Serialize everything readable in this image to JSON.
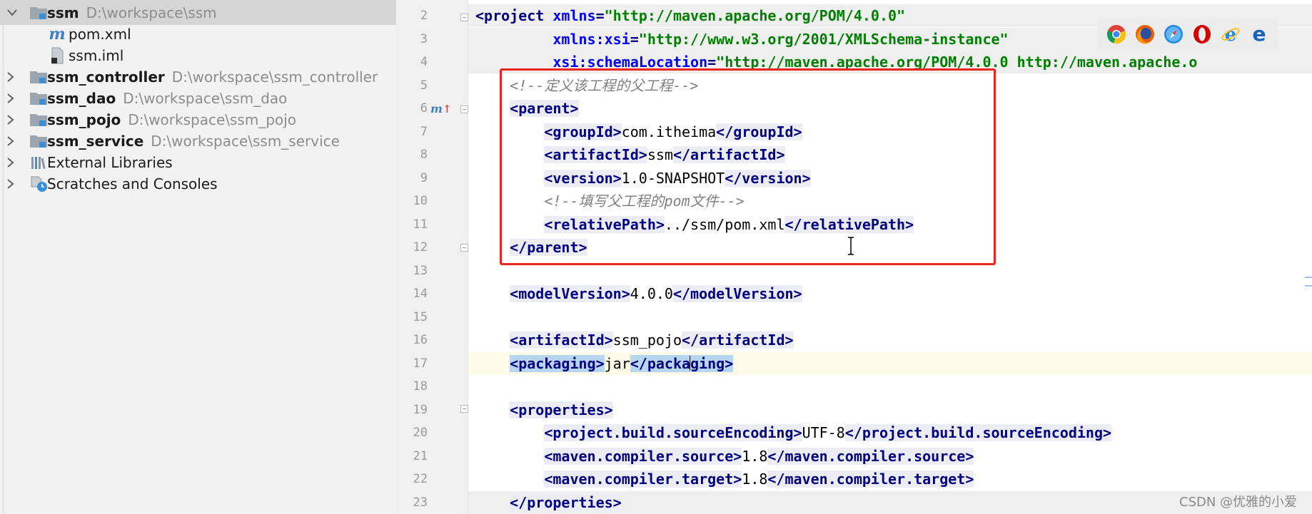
{
  "project_tree": {
    "items": [
      {
        "label": "ssm",
        "path": "D:\\workspace\\ssm",
        "kind": "module",
        "expanded": true,
        "selected": true
      },
      {
        "label": "pom.xml",
        "path": "",
        "kind": "maven-file",
        "expanded": false,
        "selected": false
      },
      {
        "label": "ssm.iml",
        "path": "",
        "kind": "iml-file",
        "expanded": false,
        "selected": false
      },
      {
        "label": "ssm_controller",
        "path": "D:\\workspace\\ssm_controller",
        "kind": "module",
        "expanded": false,
        "selected": false
      },
      {
        "label": "ssm_dao",
        "path": "D:\\workspace\\ssm_dao",
        "kind": "module",
        "expanded": false,
        "selected": false
      },
      {
        "label": "ssm_pojo",
        "path": "D:\\workspace\\ssm_pojo",
        "kind": "module",
        "expanded": false,
        "selected": false
      },
      {
        "label": "ssm_service",
        "path": "D:\\workspace\\ssm_service",
        "kind": "module",
        "expanded": false,
        "selected": false
      },
      {
        "label": "External Libraries",
        "path": "",
        "kind": "libraries",
        "expanded": false,
        "selected": false
      },
      {
        "label": "Scratches and Consoles",
        "path": "",
        "kind": "scratches",
        "expanded": false,
        "selected": false
      }
    ]
  },
  "editor": {
    "current_line": 17,
    "gutter_marker": "m↑",
    "lines": [
      {
        "n": "2",
        "tokens": [
          [
            "tag",
            "<project "
          ],
          [
            "attr",
            "xmlns"
          ],
          [
            "tag",
            "="
          ],
          [
            "aval",
            "\"http://maven.apache.org/POM/4.0.0\""
          ]
        ]
      },
      {
        "n": "3",
        "tokens": [
          [
            "txt",
            "         "
          ],
          [
            "attr",
            "xmlns:xsi"
          ],
          [
            "tag",
            "="
          ],
          [
            "aval",
            "\"http://www.w3.org/2001/XMLSchema-instance\""
          ]
        ]
      },
      {
        "n": "4",
        "tokens": [
          [
            "txt",
            "         "
          ],
          [
            "attr",
            "xsi:schemaLocation"
          ],
          [
            "tag",
            "="
          ],
          [
            "aval",
            "\"http://maven.apache.org/POM/4.0.0 http://maven.apache.o"
          ]
        ]
      },
      {
        "n": "5",
        "tokens": [
          [
            "txt",
            "    "
          ],
          [
            "cmt",
            "<!--定义该工程的父工程-->"
          ]
        ]
      },
      {
        "n": "6",
        "tokens": [
          [
            "txt",
            "    "
          ],
          [
            "tag",
            "<parent>"
          ]
        ]
      },
      {
        "n": "7",
        "tokens": [
          [
            "txt",
            "        "
          ],
          [
            "tag",
            "<groupId>"
          ],
          [
            "txt",
            "com.itheima"
          ],
          [
            "tag",
            "</groupId>"
          ]
        ]
      },
      {
        "n": "8",
        "tokens": [
          [
            "txt",
            "        "
          ],
          [
            "tag",
            "<artifactId>"
          ],
          [
            "txt",
            "ssm"
          ],
          [
            "tag",
            "</artifactId>"
          ]
        ]
      },
      {
        "n": "9",
        "tokens": [
          [
            "txt",
            "        "
          ],
          [
            "tag",
            "<version>"
          ],
          [
            "txt",
            "1.0-SNAPSHOT"
          ],
          [
            "tag",
            "</version>"
          ]
        ]
      },
      {
        "n": "10",
        "tokens": [
          [
            "txt",
            "        "
          ],
          [
            "cmt",
            "<!--填写父工程的pom文件-->"
          ]
        ]
      },
      {
        "n": "11",
        "tokens": [
          [
            "txt",
            "        "
          ],
          [
            "tag",
            "<relativePath>"
          ],
          [
            "txt",
            "../ssm/pom.xml"
          ],
          [
            "tag",
            "</relativePath>"
          ]
        ]
      },
      {
        "n": "12",
        "tokens": [
          [
            "txt",
            "    "
          ],
          [
            "tag",
            "</parent>"
          ]
        ]
      },
      {
        "n": "13",
        "tokens": []
      },
      {
        "n": "14",
        "tokens": [
          [
            "txt",
            "    "
          ],
          [
            "tag",
            "<modelVersion>"
          ],
          [
            "txt",
            "4.0.0"
          ],
          [
            "tag",
            "</modelVersion>"
          ]
        ]
      },
      {
        "n": "15",
        "tokens": []
      },
      {
        "n": "16",
        "tokens": [
          [
            "txt",
            "    "
          ],
          [
            "tag",
            "<artifactId>"
          ],
          [
            "txt",
            "ssm_pojo"
          ],
          [
            "tag",
            "</artifactId>"
          ]
        ]
      },
      {
        "n": "17",
        "tokens": [
          [
            "txt",
            "    "
          ],
          [
            "tag",
            "<packaging>"
          ],
          [
            "txt",
            "jar"
          ],
          [
            "tag",
            "</packa"
          ],
          [
            "caret",
            ""
          ],
          [
            "tag",
            "ging>"
          ]
        ]
      },
      {
        "n": "18",
        "tokens": []
      },
      {
        "n": "19",
        "tokens": [
          [
            "txt",
            "    "
          ],
          [
            "tag",
            "<properties>"
          ]
        ]
      },
      {
        "n": "20",
        "tokens": [
          [
            "txt",
            "        "
          ],
          [
            "tag",
            "<project.build.sourceEncoding>"
          ],
          [
            "txt",
            "UTF-8"
          ],
          [
            "tag",
            "</project.build.sourceEncoding>"
          ]
        ]
      },
      {
        "n": "21",
        "tokens": [
          [
            "txt",
            "        "
          ],
          [
            "tag",
            "<maven.compiler.source>"
          ],
          [
            "txt",
            "1.8"
          ],
          [
            "tag",
            "</maven.compiler.source>"
          ]
        ]
      },
      {
        "n": "22",
        "tokens": [
          [
            "txt",
            "        "
          ],
          [
            "tag",
            "<maven.compiler.target>"
          ],
          [
            "txt",
            "1.8"
          ],
          [
            "tag",
            "</maven.compiler.target>"
          ]
        ]
      },
      {
        "n": "23",
        "tokens": [
          [
            "txt",
            "    "
          ],
          [
            "tag",
            "</properties>"
          ]
        ]
      }
    ]
  },
  "browser_icons": [
    "chrome-icon",
    "firefox-icon",
    "safari-icon",
    "opera-icon",
    "internet-explorer-icon",
    "edge-icon"
  ],
  "watermark": "CSDN @优雅的小爱",
  "colors": {
    "tag": "#000080",
    "attr_name": "#0000ff",
    "attr_value": "#008000",
    "comment": "#808080",
    "annotation_box": "#e8261f",
    "current_line": "#fdfbe8",
    "match_highlight": "#b6d7ef"
  }
}
